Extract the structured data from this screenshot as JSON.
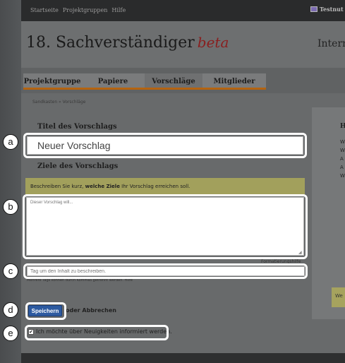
{
  "topbar": {
    "nav": [
      "Startseite",
      "Projektgruppen",
      "Hilfe"
    ],
    "user": "Testnut"
  },
  "header": {
    "title": "18. Sachverständiger",
    "beta": "beta",
    "tagline": "Intern"
  },
  "tabs": [
    "Projektgruppe",
    "Papiere",
    "Vorschläge",
    "Mitglieder"
  ],
  "breadcrumb": "Sandkasten » Vorschläge",
  "form": {
    "title_label": "Titel des Vorschlags",
    "title_value": "Neuer Vorschlag",
    "goals_label": "Ziele des Vorschlags",
    "hint_prefix": "Beschreiben Sie kurz, ",
    "hint_bold": "welche Ziele",
    "hint_suffix": " Ihr Vorschlag erreichen soll.",
    "goals_placeholder": "Dieser Vorschlag will...",
    "format_help": "Formatierungshilfe",
    "tag_placeholder": "Tag um den Inhalt zu beschreiben.",
    "tag_hint": "Mehrere Tags können durch Kommas getrennt werden.",
    "tag_hint_link": "Hilfe",
    "save_label": "Speichern",
    "or_text": "oder",
    "cancel_label": "Abbrechen",
    "notify_label": "Ich möchte über Neuigkeiten informiert werden."
  },
  "sidebar": {
    "heading": "H",
    "items": [
      "W",
      "W",
      "A",
      "A",
      "W"
    ],
    "note": "We"
  },
  "callouts": [
    "a",
    "b",
    "c",
    "d",
    "e"
  ]
}
